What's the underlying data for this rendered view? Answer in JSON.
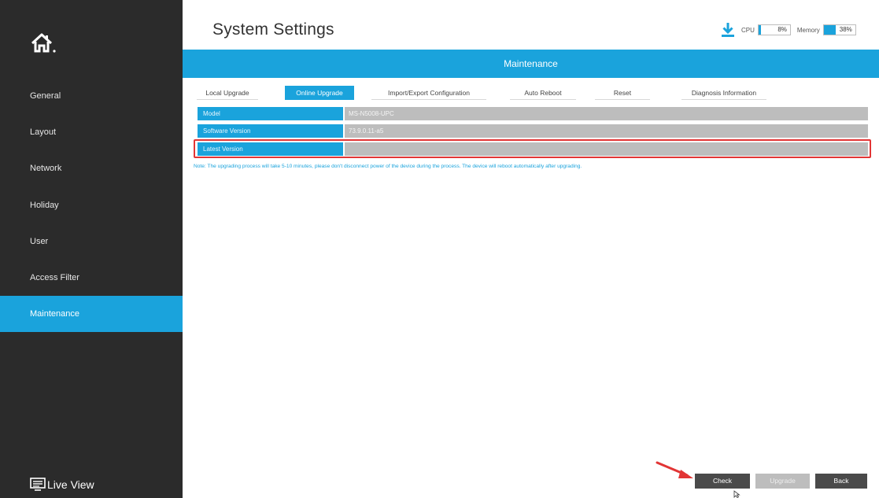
{
  "header": {
    "title": "System Settings",
    "cpu_label": "CPU",
    "cpu_value": "8%",
    "cpu_fraction": 0.08,
    "memory_label": "Memory",
    "memory_value": "38%",
    "memory_fraction": 0.38
  },
  "sidebar": {
    "home_icon": "home-icon",
    "items": [
      {
        "label": "General"
      },
      {
        "label": "Layout"
      },
      {
        "label": "Network"
      },
      {
        "label": "Holiday"
      },
      {
        "label": "User"
      },
      {
        "label": "Access Filter"
      },
      {
        "label": "Maintenance",
        "active": true
      }
    ],
    "live_view": "Live View"
  },
  "section": {
    "title": "Maintenance"
  },
  "tabs": [
    {
      "label": "Local Upgrade"
    },
    {
      "label": "Online Upgrade",
      "active": true
    },
    {
      "label": "Import/Export Configuration"
    },
    {
      "label": "Auto Reboot"
    },
    {
      "label": "Reset"
    },
    {
      "label": "Diagnosis Information"
    }
  ],
  "rows": [
    {
      "label": "Model",
      "value": "MS-N5008-UPC"
    },
    {
      "label": "Software Version",
      "value": "73.9.0.11-a5"
    },
    {
      "label": "Latest Version",
      "value": ""
    }
  ],
  "note": "Note: The upgrading process will take 5-10 minutes, please don't disconnect power of the device during the process. The device will reboot automatically after upgrading.",
  "buttons": {
    "check": "Check",
    "upgrade": "Upgrade",
    "back": "Back"
  },
  "colors": {
    "accent": "#1aa3dc",
    "sidebar": "#2b2b2b",
    "highlight": "#e23535"
  }
}
